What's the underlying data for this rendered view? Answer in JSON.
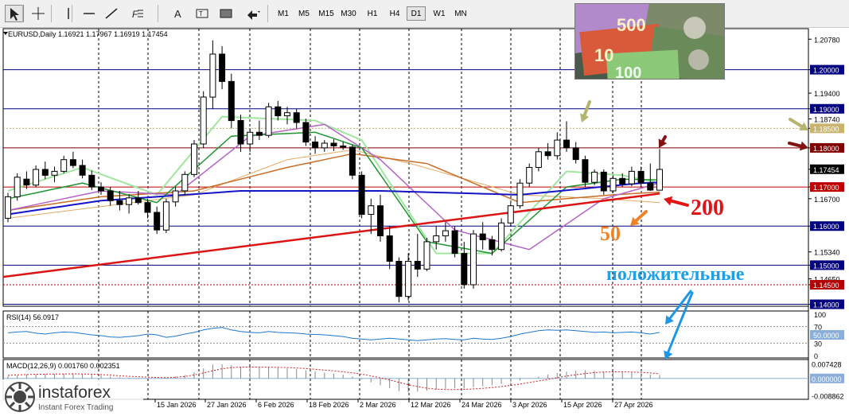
{
  "toolbar": {
    "tools": [
      "cursor",
      "crosshair",
      "vertical-line",
      "horizontal-line",
      "trendline",
      "fibonacci",
      "text",
      "label",
      "shapes",
      "arrows"
    ],
    "timeframes": [
      "M1",
      "M5",
      "M15",
      "M30",
      "H1",
      "H4",
      "D1",
      "W1",
      "MN"
    ],
    "active_timeframe": "D1"
  },
  "chart_data": {
    "type": "candlestick",
    "title": "EURUSD,Daily  1.16921 1.17967 1.16919 1.17454",
    "symbol": "EURUSD",
    "timeframe": "Daily",
    "ohlc_last": {
      "open": 1.16921,
      "high": 1.17967,
      "low": 1.16919,
      "close": 1.17454
    },
    "price_axis": {
      "ticks": [
        1.2078,
        1.2,
        1.194,
        1.19,
        1.1874,
        1.185,
        1.18,
        1.17454,
        1.17,
        1.167,
        1.16,
        1.1534,
        1.15,
        1.1465,
        1.145,
        1.14
      ],
      "tick_labels": [
        "1.20780",
        "1.20000",
        "1.19400",
        "1.19000",
        "1.18740",
        "1.18500",
        "1.18000",
        "1.17454",
        "1.17000",
        "1.16700",
        "1.16000",
        "1.15340",
        "1.15000",
        "1.14650",
        "1.14500",
        "1.14000"
      ],
      "ylim": [
        1.1395,
        1.2105
      ]
    },
    "date_axis": {
      "labels": [
        "15 Jan 2026",
        "27 Jan 2026",
        "6 Feb 2026",
        "18 Feb 2026",
        "2 Mar 2026",
        "12 Mar 2026",
        "24 Mar 2026",
        "3 Apr 2026",
        "15 Apr 2026",
        "27 Apr 2026"
      ]
    },
    "levels": [
      {
        "price": 1.2,
        "label": "1.20000",
        "color": "#000080",
        "style": "solid"
      },
      {
        "price": 1.19,
        "label": "1.19000",
        "color": "#000080",
        "style": "solid"
      },
      {
        "price": 1.185,
        "label": "1.18500",
        "color": "#c8b46e",
        "style": "dotted"
      },
      {
        "price": 1.18,
        "label": "1.18000",
        "color": "#800000",
        "style": "solid"
      },
      {
        "price": 1.17,
        "label": "1.17000",
        "color": "#c00000",
        "style": "solid"
      },
      {
        "price": 1.16,
        "label": "1.16000",
        "color": "#000080",
        "style": "solid"
      },
      {
        "price": 1.15,
        "label": "1.15000",
        "color": "#000080",
        "style": "solid"
      },
      {
        "price": 1.145,
        "label": "1.14500",
        "color": "#b40000",
        "style": "dotted"
      },
      {
        "price": 1.14,
        "label": "1.14000",
        "color": "#000080",
        "style": "solid"
      }
    ],
    "candles": [
      [
        1.162,
        1.1685,
        1.161,
        1.1675
      ],
      [
        1.1675,
        1.1735,
        1.1665,
        1.1725
      ],
      [
        1.172,
        1.174,
        1.1695,
        1.1705
      ],
      [
        1.1705,
        1.1755,
        1.17,
        1.1745
      ],
      [
        1.1745,
        1.1765,
        1.172,
        1.173
      ],
      [
        1.173,
        1.1752,
        1.1712,
        1.174
      ],
      [
        1.174,
        1.178,
        1.1735,
        1.177
      ],
      [
        1.177,
        1.179,
        1.1748,
        1.1755
      ],
      [
        1.1755,
        1.177,
        1.1722,
        1.173
      ],
      [
        1.173,
        1.1742,
        1.1692,
        1.17
      ],
      [
        1.17,
        1.1712,
        1.168,
        1.169
      ],
      [
        1.169,
        1.17,
        1.1652,
        1.1665
      ],
      [
        1.1665,
        1.169,
        1.164,
        1.1655
      ],
      [
        1.1655,
        1.1682,
        1.1632,
        1.1672
      ],
      [
        1.1672,
        1.169,
        1.1655,
        1.166
      ],
      [
        1.166,
        1.167,
        1.162,
        1.1635
      ],
      [
        1.1635,
        1.165,
        1.158,
        1.159
      ],
      [
        1.159,
        1.167,
        1.1582,
        1.1662
      ],
      [
        1.1662,
        1.17,
        1.165,
        1.169
      ],
      [
        1.169,
        1.174,
        1.168,
        1.1732
      ],
      [
        1.1732,
        1.182,
        1.1725,
        1.181
      ],
      [
        1.181,
        1.1945,
        1.18,
        1.193
      ],
      [
        1.193,
        1.2075,
        1.19,
        1.204
      ],
      [
        1.204,
        1.206,
        1.195,
        1.197
      ],
      [
        1.197,
        1.199,
        1.185,
        1.187
      ],
      [
        1.187,
        1.1885,
        1.179,
        1.181
      ],
      [
        1.181,
        1.185,
        1.179,
        1.184
      ],
      [
        1.184,
        1.187,
        1.182,
        1.1832
      ],
      [
        1.1832,
        1.1915,
        1.1826,
        1.1905
      ],
      [
        1.1905,
        1.192,
        1.187,
        1.1882
      ],
      [
        1.1882,
        1.1905,
        1.186,
        1.189
      ],
      [
        1.189,
        1.19,
        1.185,
        1.1865
      ],
      [
        1.1865,
        1.1875,
        1.1805,
        1.1815
      ],
      [
        1.1815,
        1.183,
        1.1785,
        1.18
      ],
      [
        1.18,
        1.182,
        1.179,
        1.1812
      ],
      [
        1.1812,
        1.1822,
        1.1792,
        1.1805
      ],
      [
        1.1805,
        1.1815,
        1.1795,
        1.1802
      ],
      [
        1.1802,
        1.1808,
        1.172,
        1.173
      ],
      [
        1.173,
        1.174,
        1.162,
        1.163
      ],
      [
        1.163,
        1.167,
        1.158,
        1.1652
      ],
      [
        1.1652,
        1.168,
        1.156,
        1.1575
      ],
      [
        1.1575,
        1.16,
        1.149,
        1.151
      ],
      [
        1.151,
        1.152,
        1.1405,
        1.142
      ],
      [
        1.142,
        1.153,
        1.141,
        1.151
      ],
      [
        1.151,
        1.158,
        1.147,
        1.149
      ],
      [
        1.149,
        1.157,
        1.1485,
        1.156
      ],
      [
        1.156,
        1.16,
        1.154,
        1.1575
      ],
      [
        1.1575,
        1.161,
        1.156,
        1.1588
      ],
      [
        1.1588,
        1.16,
        1.152,
        1.153
      ],
      [
        1.153,
        1.156,
        1.144,
        1.145
      ],
      [
        1.145,
        1.159,
        1.144,
        1.158
      ],
      [
        1.158,
        1.161,
        1.154,
        1.1565
      ],
      [
        1.1565,
        1.1575,
        1.1525,
        1.154
      ],
      [
        1.154,
        1.162,
        1.1535,
        1.1608
      ],
      [
        1.1608,
        1.166,
        1.16,
        1.1652
      ],
      [
        1.1652,
        1.172,
        1.1645,
        1.171
      ],
      [
        1.171,
        1.176,
        1.17,
        1.175
      ],
      [
        1.175,
        1.18,
        1.174,
        1.179
      ],
      [
        1.179,
        1.1812,
        1.177,
        1.178
      ],
      [
        1.178,
        1.184,
        1.177,
        1.182
      ],
      [
        1.182,
        1.1868,
        1.179,
        1.18
      ],
      [
        1.18,
        1.1815,
        1.176,
        1.177
      ],
      [
        1.177,
        1.178,
        1.17,
        1.1712
      ],
      [
        1.1712,
        1.1745,
        1.1705,
        1.1738
      ],
      [
        1.1738,
        1.1745,
        1.168,
        1.169
      ],
      [
        1.169,
        1.173,
        1.1685,
        1.1722
      ],
      [
        1.1722,
        1.1735,
        1.17,
        1.1708
      ],
      [
        1.1708,
        1.1752,
        1.1702,
        1.174
      ],
      [
        1.174,
        1.1752,
        1.17,
        1.171
      ],
      [
        1.171,
        1.176,
        1.169,
        1.1692
      ],
      [
        1.1692,
        1.1797,
        1.1692,
        1.1745
      ]
    ],
    "sma200": {
      "color": "#dc1414",
      "from": 1.147,
      "to": 1.1683
    },
    "sma100": {
      "color": "#1414c8",
      "knots": [
        [
          0,
          1.163
        ],
        [
          10,
          1.1665
        ],
        [
          25,
          1.169
        ],
        [
          40,
          1.169
        ],
        [
          55,
          1.168
        ],
        [
          68,
          1.171
        ],
        [
          70,
          1.1712
        ]
      ]
    },
    "sma50": {
      "color": "#c86e28",
      "knots": [
        [
          0,
          1.164
        ],
        [
          10,
          1.1675
        ],
        [
          20,
          1.169
        ],
        [
          30,
          1.175
        ],
        [
          37,
          1.1785
        ],
        [
          45,
          1.176
        ],
        [
          55,
          1.166
        ],
        [
          65,
          1.168
        ],
        [
          70,
          1.1687
        ]
      ]
    },
    "ma_green": {
      "color": "#1e9632",
      "knots": [
        [
          0,
          1.167
        ],
        [
          8,
          1.171
        ],
        [
          16,
          1.166
        ],
        [
          24,
          1.183
        ],
        [
          33,
          1.184
        ],
        [
          38,
          1.18
        ],
        [
          45,
          1.156
        ],
        [
          52,
          1.153
        ],
        [
          60,
          1.17
        ],
        [
          66,
          1.172
        ],
        [
          70,
          1.1718
        ]
      ]
    },
    "ma_lightgreen": {
      "color": "#a0e6a0",
      "knots": [
        [
          0,
          1.169
        ],
        [
          8,
          1.175
        ],
        [
          16,
          1.168
        ],
        [
          23,
          1.188
        ],
        [
          33,
          1.187
        ],
        [
          38,
          1.182
        ],
        [
          46,
          1.153
        ],
        [
          52,
          1.153
        ],
        [
          60,
          1.174
        ],
        [
          66,
          1.173
        ],
        [
          70,
          1.171
        ]
      ]
    },
    "ma_violet": {
      "color": "#b464c8",
      "knots": [
        [
          0,
          1.164
        ],
        [
          10,
          1.169
        ],
        [
          18,
          1.168
        ],
        [
          26,
          1.183
        ],
        [
          34,
          1.186
        ],
        [
          40,
          1.177
        ],
        [
          48,
          1.159
        ],
        [
          56,
          1.154
        ],
        [
          64,
          1.167
        ],
        [
          70,
          1.171
        ]
      ]
    },
    "ma_lightorange": {
      "color": "#e6aa64",
      "knots": [
        [
          0,
          1.162
        ],
        [
          10,
          1.165
        ],
        [
          20,
          1.168
        ],
        [
          30,
          1.177
        ],
        [
          37,
          1.1795
        ],
        [
          44,
          1.1755
        ],
        [
          55,
          1.168
        ],
        [
          64,
          1.167
        ],
        [
          70,
          1.166
        ]
      ]
    },
    "rsi": {
      "label": "RSI(14) 56.0917",
      "levels": [
        70,
        30
      ],
      "ticks": [
        "100",
        "70",
        "50.0000",
        "30",
        "0"
      ],
      "color": "#1e78c8",
      "values": [
        55,
        57,
        58,
        54,
        52,
        55,
        57,
        56,
        53,
        50,
        48,
        45,
        44,
        46,
        48,
        52,
        50,
        44,
        47,
        52,
        56,
        62,
        66,
        68,
        62,
        58,
        56,
        55,
        58,
        56,
        55,
        54,
        52,
        51,
        50,
        48,
        46,
        42,
        40,
        38,
        40,
        42,
        40,
        38,
        36,
        38,
        40,
        41,
        39,
        38,
        42,
        40,
        39,
        42,
        46,
        52,
        56,
        60,
        62,
        61,
        62,
        60,
        58,
        56,
        57,
        55,
        56,
        57,
        55,
        52,
        56
      ]
    },
    "macd": {
      "label": "MACD(12,26,9) 0.001760 0.002351",
      "ticks": [
        "0.007428",
        "0.000000",
        "-0.008862"
      ],
      "ylim": [
        -0.0095,
        0.0085
      ],
      "hist": [
        0.0012,
        0.0016,
        0.0021,
        0.0022,
        0.0024,
        0.0023,
        0.0025,
        0.0026,
        0.0023,
        0.0019,
        0.0015,
        0.001,
        0.0006,
        0.0004,
        0.0002,
        0.0001,
        0.0,
        0.0003,
        0.0009,
        0.0018,
        0.0032,
        0.0052,
        0.0072,
        0.0073,
        0.0068,
        0.006,
        0.0058,
        0.0055,
        0.0058,
        0.0055,
        0.0052,
        0.0048,
        0.0042,
        0.0036,
        0.003,
        0.0025,
        0.002,
        0.001,
        -0.0005,
        -0.002,
        -0.0035,
        -0.005,
        -0.0065,
        -0.007,
        -0.0068,
        -0.0063,
        -0.0058,
        -0.0053,
        -0.005,
        -0.0052,
        -0.0045,
        -0.004,
        -0.0035,
        -0.0028,
        -0.002,
        -0.001,
        0.0,
        0.001,
        0.002,
        0.0028,
        0.0035,
        0.004,
        0.0042,
        0.004,
        0.0036,
        0.0034,
        0.0032,
        0.003,
        0.0026,
        0.002,
        0.0018
      ],
      "signal": [
        0.0016,
        0.0018,
        0.002,
        0.0021,
        0.0022,
        0.0023,
        0.0023,
        0.0024,
        0.0023,
        0.0022,
        0.002,
        0.0017,
        0.0014,
        0.0011,
        0.0009,
        0.0007,
        0.0005,
        0.0004,
        0.0006,
        0.001,
        0.0018,
        0.0028,
        0.004,
        0.005,
        0.0056,
        0.0058,
        0.0059,
        0.0058,
        0.0058,
        0.0057,
        0.0056,
        0.0054,
        0.0051,
        0.0047,
        0.0043,
        0.0039,
        0.0034,
        0.0029,
        0.0022,
        0.0013,
        0.0003,
        -0.0008,
        -0.002,
        -0.0032,
        -0.0042,
        -0.005,
        -0.0055,
        -0.0057,
        -0.0057,
        -0.0056,
        -0.0054,
        -0.0051,
        -0.0047,
        -0.0042,
        -0.0036,
        -0.0029,
        -0.0021,
        -0.0013,
        -0.0005,
        0.0004,
        0.0012,
        0.0019,
        0.0025,
        0.003,
        0.0033,
        0.0034,
        0.0034,
        0.0033,
        0.0031,
        0.0028,
        0.0024
      ]
    },
    "annotations": [
      {
        "text": "200",
        "color": "#e01414"
      },
      {
        "text": "50",
        "color": "#f08228"
      },
      {
        "text": "положительные",
        "color": "#1ea0e6"
      }
    ]
  },
  "branding": {
    "logo_name": "instaforex",
    "logo_sub": "Instant Forex Trading",
    "banknotes": [
      "500",
      "10",
      "100"
    ]
  }
}
